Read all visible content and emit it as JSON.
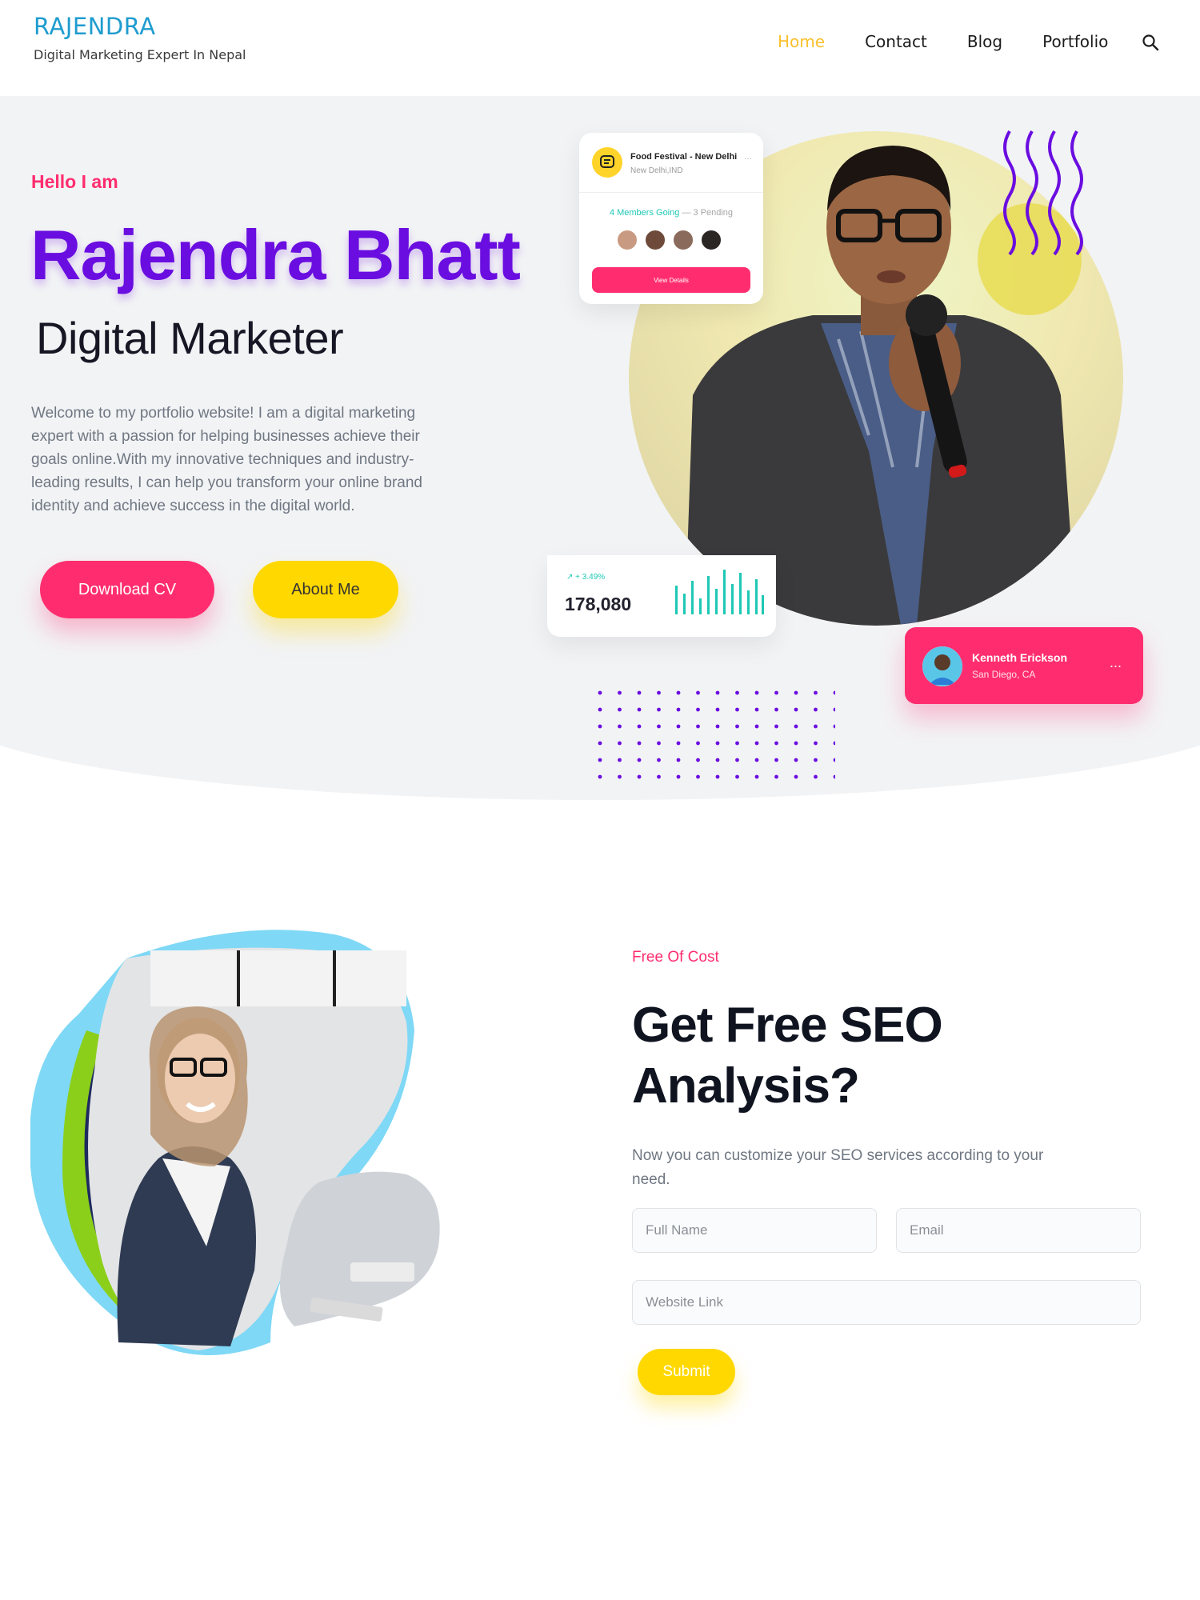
{
  "header": {
    "brand": "RAJENDRA",
    "tagline": "Digital Marketing Expert In Nepal",
    "nav": [
      "Home",
      "Contact",
      "Blog",
      "Portfolio"
    ],
    "active_nav": "Home",
    "search_icon": "search-icon"
  },
  "hero": {
    "greeting": "Hello I am",
    "name": "Rajendra Bhatt",
    "role": "Digital Marketer",
    "description": "Welcome to my portfolio website! I am a digital marketing expert with a passion for helping businesses achieve their goals online.With my innovative techniques and industry-leading results, I can help you transform your online brand identity and achieve success in the digital world.",
    "buttons": {
      "download_cv": "Download CV",
      "about_me": "About Me"
    },
    "event_card": {
      "title": "Food Festival - New Delhi",
      "location": "New Delhi,IND",
      "going": "4 Members Going",
      "pending": "— 3 Pending",
      "button": "View Details",
      "more": "..."
    },
    "stat_card": {
      "trend": "+ 3.49%",
      "value": "178,080"
    },
    "person_card": {
      "name": "Kenneth Erickson",
      "location": "San Diego, CA",
      "more": "..."
    },
    "colors": {
      "pink": "#ff2d6f",
      "yellow": "#ffd800",
      "purple": "#6a0de0",
      "teal": "#1ec8b5"
    }
  },
  "seo": {
    "eyebrow": "Free Of Cost",
    "title": "Get Free SEO Analysis?",
    "description": "Now you can customize your SEO services according to your need.",
    "form": {
      "full_name_placeholder": "Full Name",
      "email_placeholder": "Email",
      "website_placeholder": "Website Link",
      "submit": "Submit"
    }
  }
}
